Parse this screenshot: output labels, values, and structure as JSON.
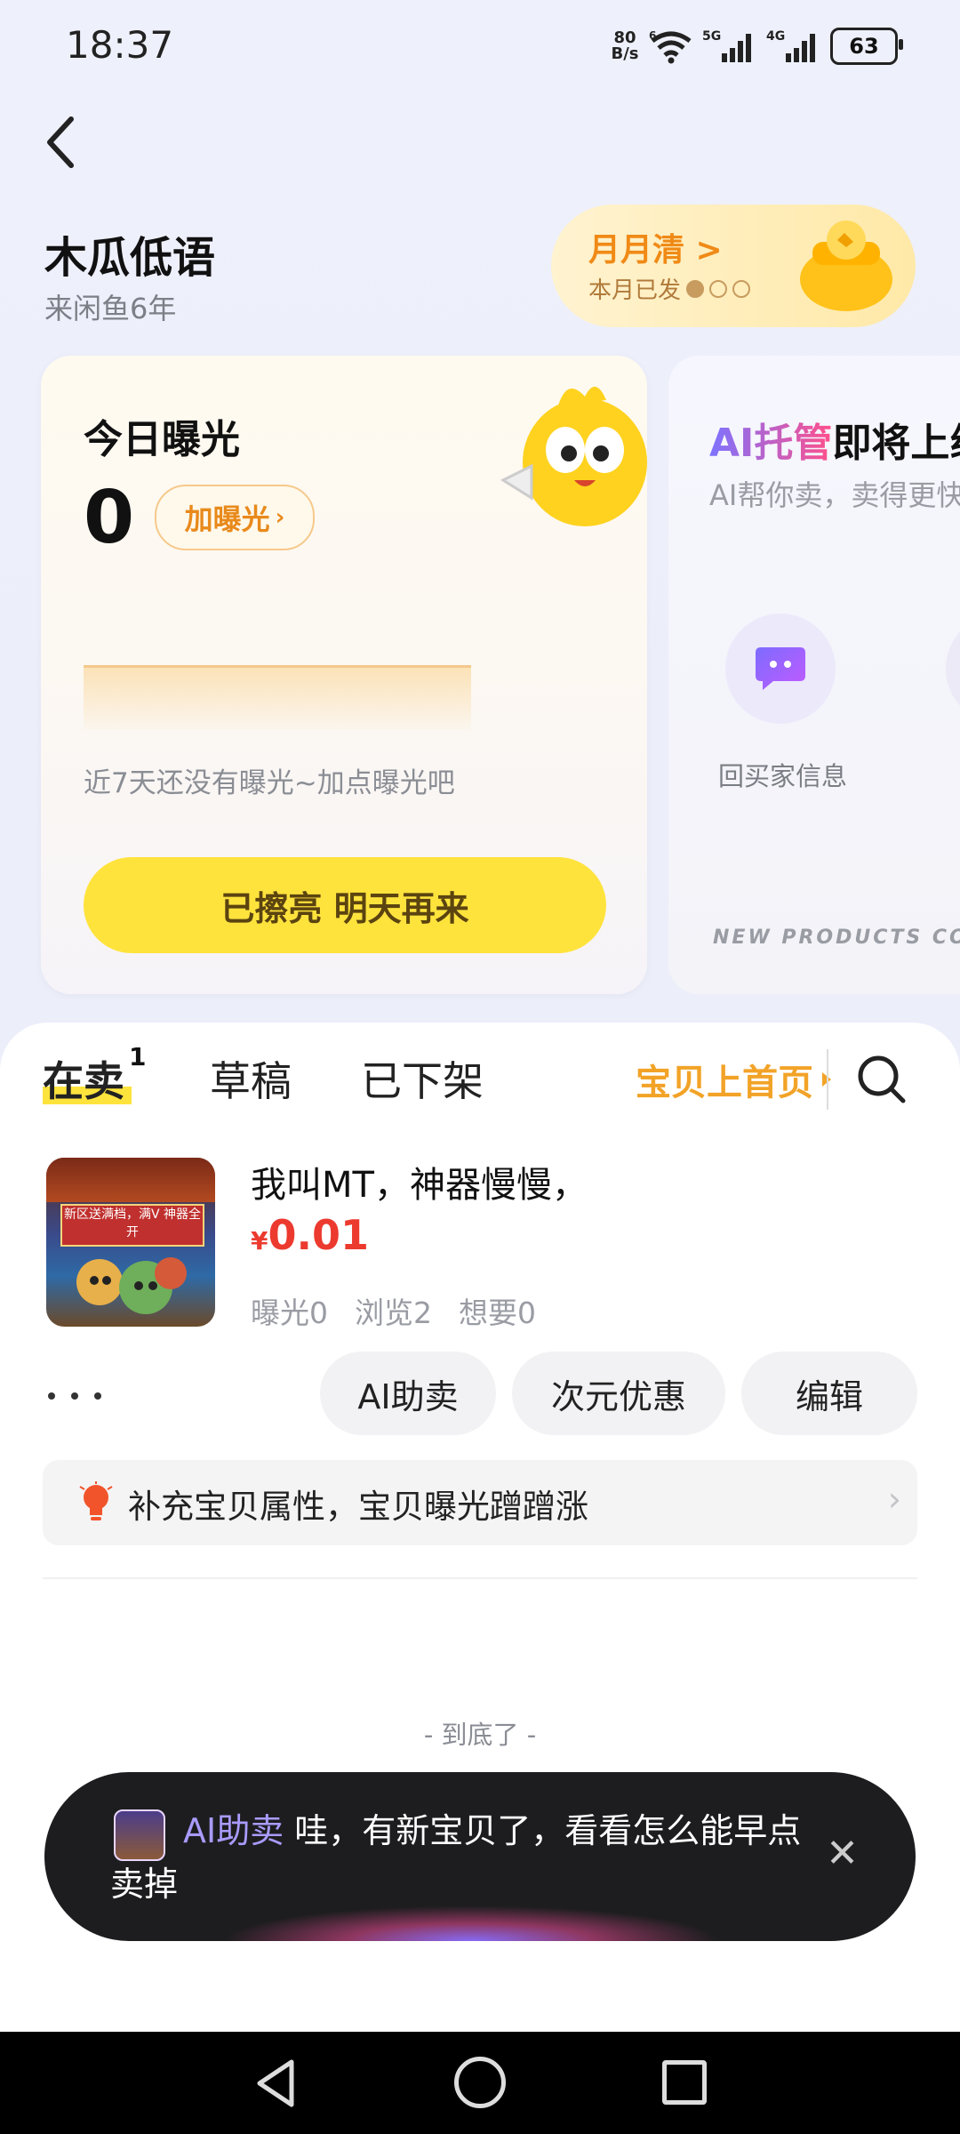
{
  "status_bar": {
    "time": "18:37",
    "net_speed_value": "80",
    "net_speed_unit": "B/s",
    "wifi_label": "6",
    "sim1_label": "5G",
    "sim2_label": "4G",
    "battery": "63"
  },
  "profile": {
    "name": "木瓜低语",
    "subtitle": "来闲鱼6年"
  },
  "monthly_badge": {
    "title": "月月清 >",
    "subtitle": "本月已发",
    "progress_filled": 1,
    "progress_total": 3
  },
  "exposure_card": {
    "title": "今日曝光",
    "count": "0",
    "add_button": "加曝光",
    "hint": "近7天还没有曝光~加点曝光吧",
    "action_button": "已擦亮 明天再来"
  },
  "ai_card": {
    "title_prefix": "AI托管",
    "title_rest": "即将上线",
    "subtitle": "AI帮你卖，卖得更快",
    "feature_label": "回买家信息",
    "footer": "NEW PRODUCTS COMING"
  },
  "tabs": {
    "on_sale": "在卖",
    "on_sale_count": "1",
    "drafts": "草稿",
    "removed": "已下架",
    "promote": "宝贝上首页"
  },
  "product": {
    "title": "我叫MT，神器慢慢，",
    "currency": "¥",
    "price": "0.01",
    "image_banner": "新区送满档，满V 神器全开",
    "stats": [
      "曝光0",
      "浏览2",
      "想要0"
    ]
  },
  "actions": {
    "ai_sell": "AI助卖",
    "discount": "次元优惠",
    "edit": "编辑"
  },
  "tip": {
    "text": "补充宝贝属性，宝贝曝光蹭蹭涨",
    "arrow": "›"
  },
  "end_text": "- 到底了 -",
  "toast": {
    "brand": "AI助卖",
    "message": " 哇，有新宝贝了，看看怎么能早点卖掉",
    "close": "✕"
  },
  "colors": {
    "accent_yellow": "#ffe33d",
    "price_red": "#ec3a2f",
    "promote_orange": "#f2a327"
  }
}
